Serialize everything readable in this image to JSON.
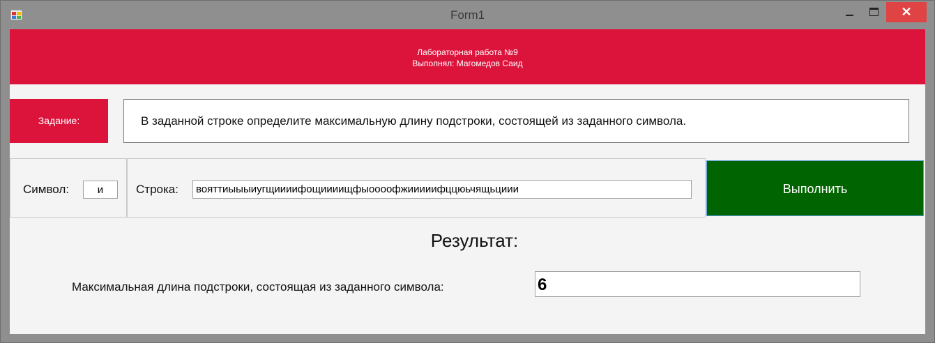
{
  "window": {
    "title": "Form1",
    "close_glyph": "✕"
  },
  "header": {
    "line1": "Лабораторная работа №9",
    "line2": "Выполнял: Магомедов Саид",
    "color": "#dc143c"
  },
  "task": {
    "label": "Задание:",
    "text": "В заданной строке определите максимальную длину подстроки, состоящей из заданного символа."
  },
  "inputs": {
    "symbol_label": "Символ:",
    "symbol_value": "и",
    "string_label": "Строка:",
    "string_value": "вояттиыыыиугщиииифощиииищфыоооофжииииифццюьчящьциии"
  },
  "run_button": {
    "label": "Выполнить",
    "color": "#006400"
  },
  "result": {
    "title": "Результат:",
    "label": "Максимальная длина подстроки, состоящая из заданного символа:",
    "value": "6"
  },
  "icons": [
    "app-icon",
    "minimize-icon",
    "maximize-icon",
    "close-icon"
  ]
}
